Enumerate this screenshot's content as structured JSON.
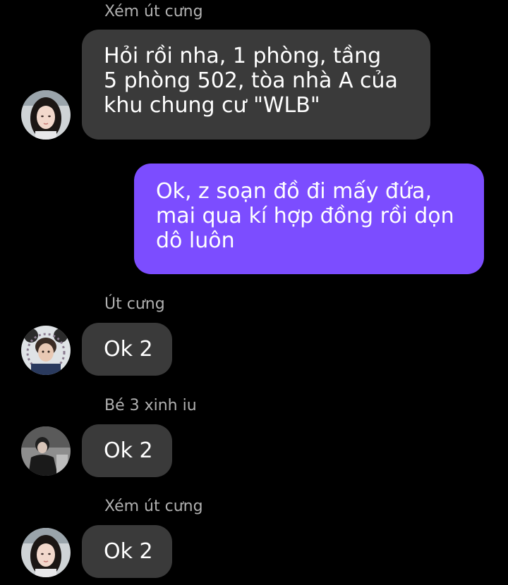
{
  "messages": [
    {
      "sender": "Xém út cưng",
      "text": "Hỏi rồi nha, 1 phòng, tầng\n5 phòng 502, tòa nhà A của\nkhu chung cư \"WLB\"",
      "direction": "incoming",
      "avatar_icon": "girl-avatar-icon"
    },
    {
      "text": "Ok, z soạn đồ đi mấy đứa,\nmai qua kí hợp đồng rồi dọn\ndô luôn",
      "direction": "outgoing"
    },
    {
      "sender": "Út cưng",
      "text": "Ok 2",
      "direction": "incoming",
      "avatar_icon": "boy-avatar-icon"
    },
    {
      "sender": "Bé 3 xinh iu",
      "text": "Ok 2",
      "direction": "incoming",
      "avatar_icon": "man-avatar-icon"
    },
    {
      "sender": "Xém út cưng",
      "text": "Ok 2",
      "direction": "incoming",
      "avatar_icon": "girl-avatar-icon"
    }
  ],
  "colors": {
    "background": "#000000",
    "incoming_bubble": "#3a3a3a",
    "outgoing_bubble": "#7c4dff",
    "sender_name": "#b0b0b0",
    "text": "#ffffff"
  }
}
